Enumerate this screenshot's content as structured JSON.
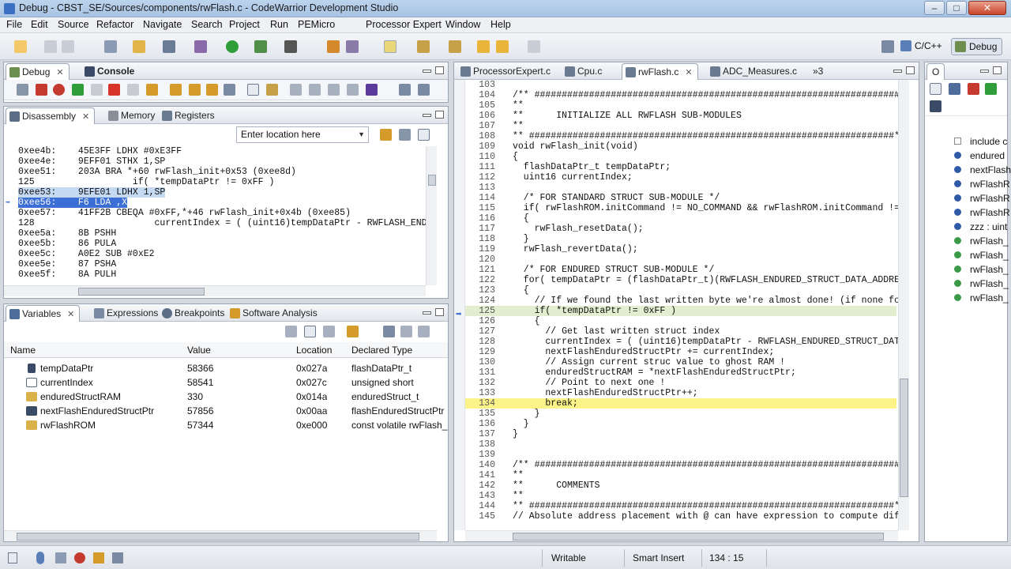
{
  "window": {
    "title": "Debug - CBST_SE/Sources/components/rwFlash.c - CodeWarrior Development Studio"
  },
  "menu": [
    "File",
    "Edit",
    "Source",
    "Refactor",
    "Navigate",
    "Search",
    "Project",
    "Run",
    "PEMicro",
    "Processor Expert",
    "Window",
    "Help"
  ],
  "perspectives": {
    "cpp": "C/C++",
    "debug": "Debug"
  },
  "debug_panel": {
    "tab_debug": "Debug",
    "tab_console": "Console"
  },
  "disasm_panel": {
    "tab_disassembly": "Disassembly",
    "tab_memory": "Memory",
    "tab_registers": "Registers",
    "location_placeholder": "Enter location here",
    "lines": [
      "0xee4b:    45E3FF LDHX #0xE3FF",
      "0xee4e:    9EFF01 STHX 1,SP",
      "0xee51:    203A BRA *+60 rwFlash_init+0x53 (0xee8d)",
      "125                  if( *tempDataPtr != 0xFF )",
      "0xee53:    9EFE01 LDHX 1,SP",
      "0xee56:    F6 LDA ,X",
      "0xee57:    41FF2B CBEQA #0xFF,*+46 rwFlash_init+0x4b (0xee85)",
      "128                      currentIndex = ( (uint16)tempDataPtr - RWFLASH_END",
      "0xee5a:    8B PSHH",
      "0xee5b:    86 PULA",
      "0xee5c:    A0E2 SUB #0xE2",
      "0xee5e:    87 PSHA",
      "0xee5f:    8A PULH"
    ]
  },
  "variables_panel": {
    "tab_variables": "Variables",
    "tab_expressions": "Expressions",
    "tab_breakpoints": "Breakpoints",
    "tab_analysis": "Software Analysis",
    "columns": [
      "Name",
      "Value",
      "Location",
      "Declared Type"
    ],
    "rows": [
      {
        "name": "tempDataPtr",
        "value": "58366",
        "location": "0x027a",
        "type": "flashDataPtr_t"
      },
      {
        "name": "currentIndex",
        "value": "58541",
        "location": "0x027c",
        "type": "unsigned short"
      },
      {
        "name": "enduredStructRAM",
        "value": "330",
        "location": "0x014a",
        "type": "enduredStruct_t"
      },
      {
        "name": "nextFlashEnduredStructPtr",
        "value": "57856",
        "location": "0x00aa",
        "type": "flashEnduredStructPtr"
      },
      {
        "name": "rwFlashROM",
        "value": "57344",
        "location": "0xe000",
        "type": "const volatile rwFlash_"
      }
    ]
  },
  "editor": {
    "tabs": [
      "ProcessorExpert.c",
      "Cpu.c",
      "rwFlash.c",
      "ADC_Measures.c"
    ],
    "overflow": "»3",
    "lines": [
      {
        "n": "103",
        "t": ""
      },
      {
        "n": "104",
        "t": "/** ###################################################################"
      },
      {
        "n": "105",
        "t": "**"
      },
      {
        "n": "106",
        "t": "**      INITIALIZE ALL RWFLASH SUB-MODULES"
      },
      {
        "n": "107",
        "t": "**"
      },
      {
        "n": "108",
        "t": "** ###################################################################*/"
      },
      {
        "n": "109",
        "t": "void rwFlash_init(void)"
      },
      {
        "n": "110",
        "t": "{"
      },
      {
        "n": "111",
        "t": "  flashDataPtr_t tempDataPtr;"
      },
      {
        "n": "112",
        "t": "  uint16 currentIndex;"
      },
      {
        "n": "113",
        "t": ""
      },
      {
        "n": "114",
        "t": "  /* FOR STANDARD STRUCT SUB-MODULE */"
      },
      {
        "n": "115",
        "t": "  if( rwFlashROM.initCommand != NO_COMMAND && rwFlashROM.initCommand != "
      },
      {
        "n": "116",
        "t": "  {"
      },
      {
        "n": "117",
        "t": "    rwFlash_resetData();"
      },
      {
        "n": "118",
        "t": "  }"
      },
      {
        "n": "119",
        "t": "  rwFlash_revertData();"
      },
      {
        "n": "120",
        "t": ""
      },
      {
        "n": "121",
        "t": "  /* FOR ENDURED STRUCT SUB-MODULE */"
      },
      {
        "n": "122",
        "t": "  for( tempDataPtr = (flashDataPtr_t)(RWFLASH_ENDURED_STRUCT_DATA_ADDRES"
      },
      {
        "n": "123",
        "t": "  {"
      },
      {
        "n": "124",
        "t": "    // If we found the last written byte we're almost done! (if none fo"
      },
      {
        "n": "125",
        "t": "    if( *tempDataPtr != 0xFF )"
      },
      {
        "n": "126",
        "t": "    {"
      },
      {
        "n": "127",
        "t": "      // Get last written struct index"
      },
      {
        "n": "128",
        "t": "      currentIndex = ( (uint16)tempDataPtr - RWFLASH_ENDURED_STRUCT_DAT"
      },
      {
        "n": "129",
        "t": "      nextFlashEnduredStructPtr += currentIndex;"
      },
      {
        "n": "130",
        "t": "      // Assign current struc value to ghost RAM !"
      },
      {
        "n": "131",
        "t": "      enduredStructRAM = *nextFlashEnduredStructPtr;"
      },
      {
        "n": "132",
        "t": "      // Point to next one !"
      },
      {
        "n": "133",
        "t": "      nextFlashEnduredStructPtr++;"
      },
      {
        "n": "134",
        "t": "      break;"
      },
      {
        "n": "135",
        "t": "    }"
      },
      {
        "n": "136",
        "t": "  }"
      },
      {
        "n": "137",
        "t": "}"
      },
      {
        "n": "138",
        "t": ""
      },
      {
        "n": "139",
        "t": ""
      },
      {
        "n": "140",
        "t": "/** ###################################################################"
      },
      {
        "n": "141",
        "t": "**"
      },
      {
        "n": "142",
        "t": "**      COMMENTS"
      },
      {
        "n": "143",
        "t": "**"
      },
      {
        "n": "144",
        "t": "** ###################################################################*/"
      },
      {
        "n": "145",
        "t": "// Absolute address placement with @ can have expression to compute dif"
      }
    ]
  },
  "outline": {
    "tab": "O",
    "items": [
      "include c",
      "endured",
      "nextFlash",
      "rwFlashR",
      "rwFlashR",
      "rwFlashR",
      "zzz : uint",
      "rwFlash_",
      "rwFlash_",
      "rwFlash_",
      "rwFlash_",
      "rwFlash_"
    ]
  },
  "status": {
    "writable": "Writable",
    "insert": "Smart Insert",
    "position": "134 : 15"
  }
}
